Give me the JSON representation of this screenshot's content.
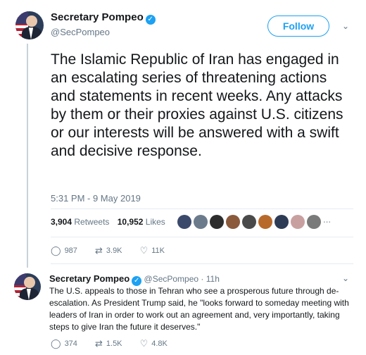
{
  "main_tweet": {
    "author_name": "Secretary Pompeo",
    "handle": "@SecPompeo",
    "follow_label": "Follow",
    "text": "The Islamic Republic of Iran has engaged in an escalating series of threatening actions and statements in recent weeks. Any attacks by them or their proxies against U.S. citizens or our interests will be answered with a swift and decisive response.",
    "timestamp": "5:31 PM - 9 May 2019",
    "retweets_count": "3,904",
    "retweets_label": "Retweets",
    "likes_count": "10,952",
    "likes_label": "Likes",
    "liker_avatar_colors": [
      "#3b4a6b",
      "#6b7b8c",
      "#2d2d2d",
      "#8a5a3b",
      "#4a4a4a",
      "#b86a2a",
      "#2e3b55",
      "#c9a0a0",
      "#7a7a7a"
    ],
    "reply_count": "987",
    "retweet_action_count": "3.9K",
    "like_action_count": "11K"
  },
  "reply_tweet": {
    "author_name": "Secretary Pompeo",
    "handle": "@SecPompeo",
    "separator": "·",
    "time": "11h",
    "text": "The U.S. appeals to those in Tehran who see a prosperous future through de-escalation. As President Trump said, he \"looks forward to someday meeting with leaders of Iran in order to work out an agreement and, very importantly, taking steps to give Iran the future it deserves.\"",
    "reply_count": "374",
    "retweet_count": "1.5K",
    "like_count": "4.8K"
  },
  "colors": {
    "accent": "#1da1f2",
    "text": "#14171a",
    "secondary": "#657786"
  },
  "icons": {
    "verified": "✓",
    "caret": "⌄",
    "reply": "◯",
    "retweet": "⇄",
    "like": "♡"
  }
}
